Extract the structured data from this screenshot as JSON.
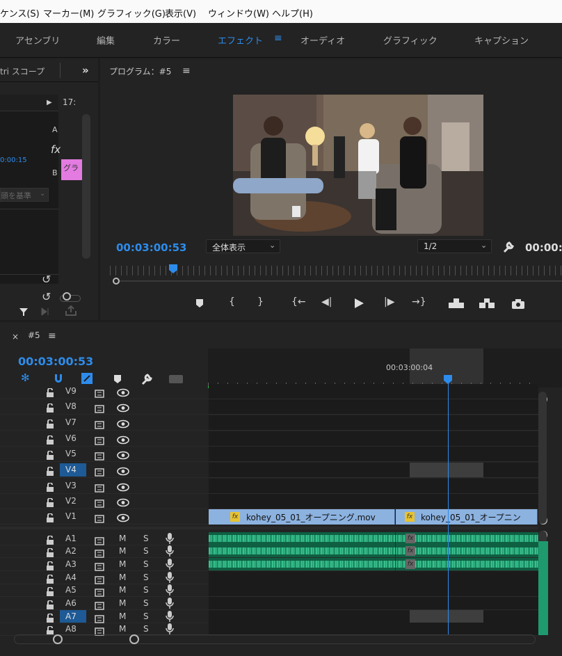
{
  "menu": [
    "ケンス(S)",
    "マーカー(M)",
    "グラフィック(G)",
    "表示(V)",
    "ウィンドウ(W)",
    "ヘルプ(H)"
  ],
  "workspaces": [
    {
      "label": "アセンブリ",
      "active": false
    },
    {
      "label": "編集",
      "active": false
    },
    {
      "label": "カラー",
      "active": false
    },
    {
      "label": "エフェクト",
      "active": true
    },
    {
      "label": "オーディオ",
      "active": false
    },
    {
      "label": "グラフィック",
      "active": false
    },
    {
      "label": "キャプション",
      "active": false
    }
  ],
  "left_panel": {
    "title": "tri スコープ",
    "time_partial": "17:",
    "label_a": "A",
    "label_b": "B",
    "fx": "fx",
    "timecode": "0:00:15",
    "clip_text": "グラ",
    "dropdown_text": "頭を基準"
  },
  "program": {
    "title": "プログラム：#5",
    "timecode": "00:03:00:53",
    "zoom": "全体表示",
    "resolution": "1/2",
    "end_time": "00:00:"
  },
  "timeline": {
    "sequence": "#5",
    "timecode": "00:03:00:53",
    "ruler_time": "00:03:00:04",
    "video_tracks": [
      {
        "name": "V9",
        "selected": false
      },
      {
        "name": "V8",
        "selected": false
      },
      {
        "name": "V7",
        "selected": false
      },
      {
        "name": "V6",
        "selected": false
      },
      {
        "name": "V5",
        "selected": false
      },
      {
        "name": "V4",
        "selected": true
      },
      {
        "name": "V3",
        "selected": false
      },
      {
        "name": "V2",
        "selected": false
      },
      {
        "name": "V1",
        "selected": false
      }
    ],
    "audio_tracks": [
      {
        "name": "A1",
        "selected": false
      },
      {
        "name": "A2",
        "selected": false
      },
      {
        "name": "A3",
        "selected": false
      },
      {
        "name": "A4",
        "selected": false
      },
      {
        "name": "A5",
        "selected": false
      },
      {
        "name": "A6",
        "selected": false
      },
      {
        "name": "A7",
        "selected": true
      },
      {
        "name": "A8",
        "selected": false
      }
    ],
    "mute_label": "M",
    "solo_label": "S",
    "clips": [
      {
        "label": "kohey_05_01_オープニング.mov",
        "fx": "fx"
      },
      {
        "label": "kohey_05_01_オープニン",
        "fx": "fx"
      }
    ],
    "audio_fx": [
      "fx",
      "fx",
      "fx"
    ]
  },
  "colors": {
    "accent": "#2d8ceb",
    "clip_video": "#8cb2e0",
    "clip_audio": "#1f9a6e",
    "render_bar": "#2bbd3c"
  }
}
